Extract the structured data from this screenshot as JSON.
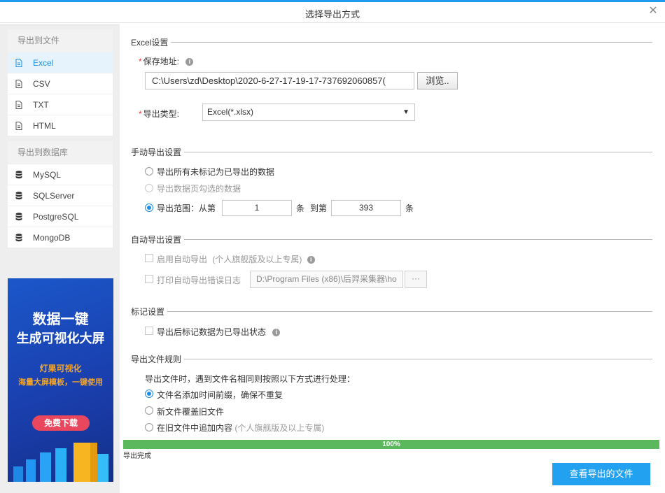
{
  "window": {
    "title": "选择导出方式",
    "close_icon": "close-icon"
  },
  "sidebar": {
    "file_group": {
      "title": "导出到文件",
      "items": [
        {
          "label": "Excel",
          "icon": "document-icon",
          "active": true
        },
        {
          "label": "CSV",
          "icon": "document-icon",
          "active": false
        },
        {
          "label": "TXT",
          "icon": "document-icon",
          "active": false
        },
        {
          "label": "HTML",
          "icon": "document-icon",
          "active": false
        }
      ]
    },
    "db_group": {
      "title": "导出到数据库",
      "items": [
        {
          "label": "MySQL",
          "icon": "database-icon"
        },
        {
          "label": "SQLServer",
          "icon": "database-icon"
        },
        {
          "label": "PostgreSQL",
          "icon": "database-icon"
        },
        {
          "label": "MongoDB",
          "icon": "database-icon"
        }
      ]
    },
    "banner": {
      "line1": "数据一键",
      "line2": "生成可视化大屏",
      "line3": "灯果可视化",
      "line4": "海量大屏模板，一键使用",
      "button": "免费下载",
      "bg_color": "#1a3fae",
      "accent_color": "#f6a623"
    }
  },
  "excel_settings": {
    "section_title": "Excel设置",
    "save_path_label": "保存地址:",
    "save_path_value": "C:\\Users\\zd\\Desktop\\2020-6-27-17-19-17-737692060857(",
    "browse_label": "浏览..",
    "type_label": "导出类型:",
    "type_value": "Excel(*.xlsx)"
  },
  "manual_export": {
    "section_title": "手动导出设置",
    "option1": "导出所有未标记为已导出的数据",
    "option2": "导出数据页勾选的数据",
    "option3_prefix": "导出范围：从第",
    "from_value": "1",
    "unit1": "条",
    "to_label": "到第",
    "to_value": "393",
    "unit2": "条"
  },
  "auto_export": {
    "section_title": "自动导出设置",
    "enable_label": "启用自动导出",
    "enable_note": "(个人旗舰版及以上专属)",
    "log_label": "打印自动导出错误日志",
    "log_path": "D:\\Program Files (x86)\\后羿采集器\\ho",
    "log_btn": "···"
  },
  "mark_settings": {
    "section_title": "标记设置",
    "mark_label": "导出后标记数据为已导出状态"
  },
  "file_rules": {
    "section_title": "导出文件规则",
    "desc": "导出文件时，遇到文件名相同则按照以下方式进行处理：",
    "option1": "文件名添加时间前缀，确保不重复",
    "option2": "新文件覆盖旧文件",
    "option3": "在旧文件中追加内容",
    "option3_note": "(个人旗舰版及以上专属)"
  },
  "progress": {
    "value": 100,
    "label": "100%",
    "color": "#5cb85c"
  },
  "status_text": "导出完成",
  "view_button": "查看导出的文件",
  "accent_color": "#1e8fe0"
}
